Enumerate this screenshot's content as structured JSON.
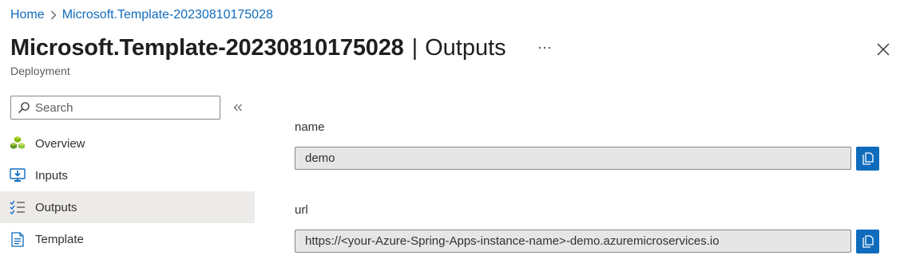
{
  "breadcrumb": {
    "home": "Home",
    "deployment": "Microsoft.Template-20230810175028"
  },
  "header": {
    "title": "Microsoft.Template-20230810175028",
    "separator": "|",
    "section": "Outputs",
    "more_icon": "ellipsis-icon",
    "close_icon": "close-icon",
    "subtitle": "Deployment"
  },
  "search": {
    "placeholder": "Search",
    "value": ""
  },
  "sidebar": {
    "items": [
      {
        "label": "Overview",
        "icon": "overview-cubes-icon",
        "active": false
      },
      {
        "label": "Inputs",
        "icon": "inputs-monitor-icon",
        "active": false
      },
      {
        "label": "Outputs",
        "icon": "outputs-checklist-icon",
        "active": true
      },
      {
        "label": "Template",
        "icon": "template-document-icon",
        "active": false
      }
    ]
  },
  "outputs": [
    {
      "name": "name",
      "value": "demo"
    },
    {
      "name": "url",
      "value": "https://<your-Azure-Spring-Apps-instance-name>-demo.azuremicroservices.io"
    }
  ],
  "colors": {
    "accent": "#0f6cbd",
    "active_nav_bg": "#edebe9",
    "readonly_field_bg": "#e6e6e6"
  }
}
